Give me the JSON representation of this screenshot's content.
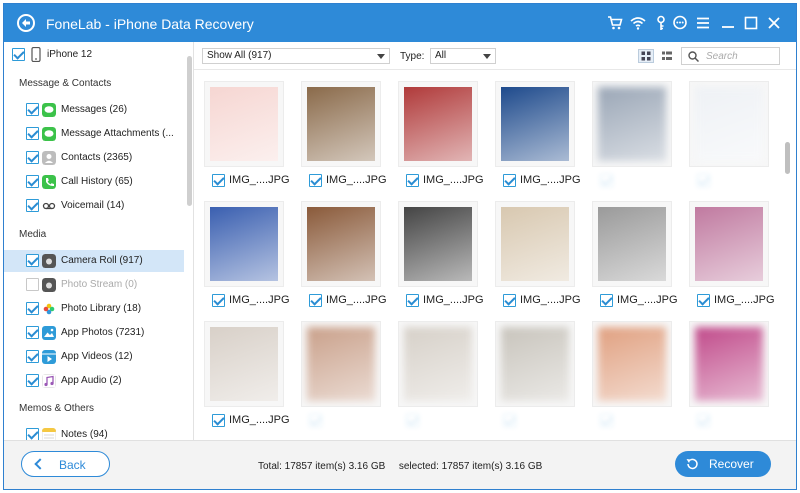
{
  "titlebar": {
    "title": "FoneLab - iPhone Data Recovery"
  },
  "sidebar": {
    "device": "iPhone 12",
    "groups": [
      {
        "title": "Message & Contacts"
      },
      {
        "title": "Media"
      },
      {
        "title": "Memos & Others"
      }
    ],
    "items": [
      {
        "label": "Messages (26)",
        "icon": "message-icon",
        "color": "#3cc24a",
        "checked": true,
        "enabled": true
      },
      {
        "label": "Message Attachments (...",
        "icon": "attachment-icon",
        "color": "#3cc24a",
        "checked": true,
        "enabled": true
      },
      {
        "label": "Contacts (2365)",
        "icon": "contacts-icon",
        "color": "#9e9e9e",
        "checked": true,
        "enabled": true
      },
      {
        "label": "Call History (65)",
        "icon": "phone-icon",
        "color": "#3cc24a",
        "checked": true,
        "enabled": true
      },
      {
        "label": "Voicemail (14)",
        "icon": "voicemail-icon",
        "color": "#555555",
        "checked": true,
        "enabled": true
      },
      {
        "label": "Camera Roll (917)",
        "icon": "camera-icon",
        "color": "#555555",
        "checked": true,
        "enabled": true,
        "active": true
      },
      {
        "label": "Photo Stream (0)",
        "icon": "camera-icon",
        "color": "#555555",
        "checked": false,
        "enabled": false
      },
      {
        "label": "Photo Library (18)",
        "icon": "photos-icon",
        "color": "#f39c12",
        "checked": true,
        "enabled": true
      },
      {
        "label": "App Photos (7231)",
        "icon": "image-icon",
        "color": "#2e9bd8",
        "checked": true,
        "enabled": true
      },
      {
        "label": "App Videos (12)",
        "icon": "video-icon",
        "color": "#2e9bd8",
        "checked": true,
        "enabled": true
      },
      {
        "label": "App Audio (2)",
        "icon": "music-icon",
        "color": "#9b59b6",
        "checked": true,
        "enabled": true
      },
      {
        "label": "Notes (94)",
        "icon": "notes-icon",
        "color": "#f5c842",
        "checked": true,
        "enabled": true
      }
    ]
  },
  "toolbar": {
    "show_filter": "Show All (917)",
    "type_label": "Type:",
    "type_value": "All",
    "search_placeholder": "Search"
  },
  "grid": {
    "items": [
      {
        "name": "IMG_....JPG",
        "blurred": false,
        "checked": true
      },
      {
        "name": "IMG_....JPG",
        "blurred": false,
        "checked": true
      },
      {
        "name": "IMG_....JPG",
        "blurred": false,
        "checked": true
      },
      {
        "name": "IMG_....JPG",
        "blurred": false,
        "checked": true
      },
      {
        "name": "",
        "blurred": true,
        "checked": true
      },
      {
        "name": "",
        "blurred": true,
        "checked": true
      },
      {
        "name": "IMG_....JPG",
        "blurred": false,
        "checked": true
      },
      {
        "name": "IMG_....JPG",
        "blurred": false,
        "checked": true
      },
      {
        "name": "IMG_....JPG",
        "blurred": false,
        "checked": true
      },
      {
        "name": "IMG_....JPG",
        "blurred": false,
        "checked": true
      },
      {
        "name": "IMG_....JPG",
        "blurred": false,
        "checked": true
      },
      {
        "name": "IMG_....JPG",
        "blurred": false,
        "checked": true
      },
      {
        "name": "IMG_....JPG",
        "blurred": false,
        "checked": true
      },
      {
        "name": "",
        "blurred": true,
        "checked": true
      },
      {
        "name": "",
        "blurred": true,
        "checked": true
      },
      {
        "name": "",
        "blurred": true,
        "checked": true
      },
      {
        "name": "",
        "blurred": true,
        "checked": true
      },
      {
        "name": "",
        "blurred": true,
        "checked": true
      }
    ],
    "colors": [
      "#f6d6d2",
      "#8a6a4a",
      "#b03a3a",
      "#1e4a8c",
      "#9aa6b6",
      "#eef1f5",
      "#3a5fb0",
      "#8a5a3a",
      "#444444",
      "#d8c8b0",
      "#9a9a9a",
      "#c07aa0",
      "#d8d0c8",
      "#c9a08a",
      "#d6d0c8",
      "#c8c4bc",
      "#e0a080",
      "#c04a8a"
    ]
  },
  "footer": {
    "back_label": "Back",
    "total": "Total: 17857 item(s) 3.16 GB",
    "selected": "selected: 17857 item(s) 3.16 GB",
    "recover_label": "Recover"
  }
}
